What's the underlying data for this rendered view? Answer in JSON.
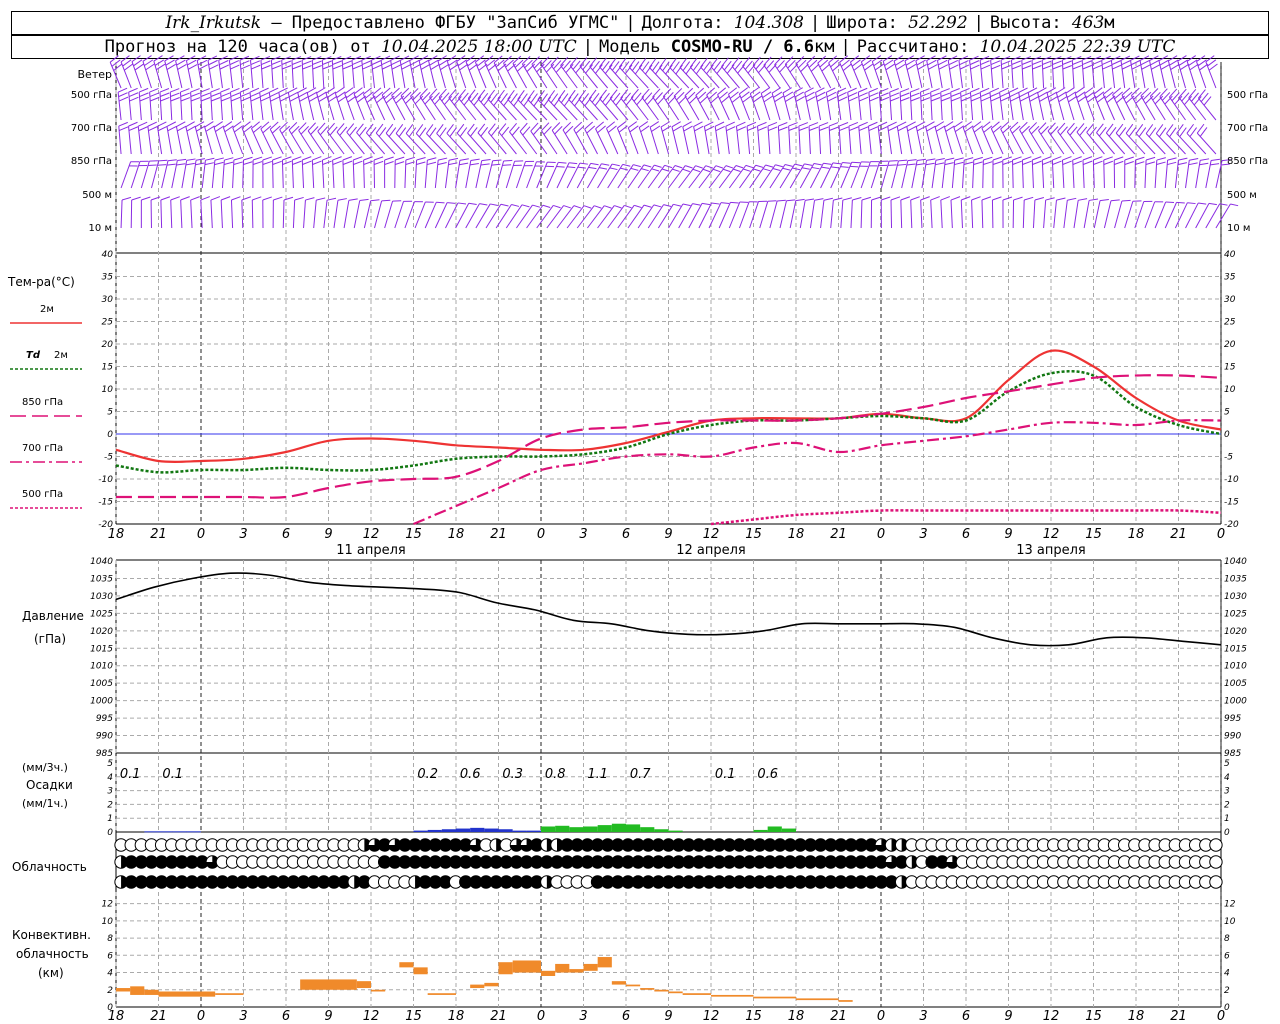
{
  "header": {
    "station": "Irk_Irkutsk",
    "provider": "— Предоставлено ФГБУ \"ЗапСиб УГМС\"",
    "lon_label": "Долгота:",
    "lon": "104.308",
    "lat_label": "Широта:",
    "lat": "52.292",
    "alt_label": "Высота:",
    "alt": "463",
    "alt_unit": "м",
    "forecast_label": "Прогноз на 120 часа(ов) от",
    "start": "10.04.2025 18:00 UTC",
    "model_label": "Модель",
    "model": "COSMO-RU / 6.6",
    "model_unit": "км",
    "calc_label": "Рассчитано:",
    "calc_time": "10.04.2025 22:39 UTC"
  },
  "wind_panel": {
    "title": "Ветер",
    "levels": [
      "500 гПа",
      "700 гПа",
      "850 гПа",
      "500 м",
      "10  м"
    ],
    "levels_right": [
      "500 гПа",
      "700 гПа",
      "850 гПа",
      "500 м",
      "10  м"
    ],
    "color": "#8a2be2"
  },
  "temp_panel": {
    "title": "Тем-ра(°С)",
    "legend": [
      {
        "label": "2м",
        "prefix": "",
        "color": "#ee3333",
        "dash": ""
      },
      {
        "label": "2м",
        "prefix": "Td",
        "color": "#117711",
        "dash": "3,2"
      },
      {
        "label": "850 гПа",
        "prefix": "",
        "color": "#dd1177",
        "dash": "16,6"
      },
      {
        "label": "700 гПа",
        "prefix": "",
        "color": "#dd1177",
        "dash": "12,4,3,4"
      },
      {
        "label": "500 гПа",
        "prefix": "",
        "color": "#dd1177",
        "dash": "3,2"
      }
    ]
  },
  "time_axis": {
    "ticks": [
      "18",
      "21",
      "0",
      "3",
      "6",
      "9",
      "12",
      "15",
      "18",
      "21",
      "0",
      "3",
      "6",
      "9",
      "12",
      "15",
      "18",
      "21",
      "0",
      "3",
      "6",
      "9",
      "12",
      "15",
      "18",
      "21",
      "0"
    ],
    "dates": [
      "11 апреля",
      "12 апреля",
      "13 апреля"
    ]
  },
  "pressure_panel": {
    "title": "Давление",
    "unit": "(гПа)"
  },
  "precip_panel": {
    "unit_top": "(мм/3ч.)",
    "title": "Осадки",
    "unit_bottom": "(мм/1ч.)",
    "labels": [
      {
        "t": 1,
        "v": "0.1"
      },
      {
        "t": 4,
        "v": "0.1"
      },
      {
        "t": 22,
        "v": "0.2"
      },
      {
        "t": 25,
        "v": "0.6"
      },
      {
        "t": 28,
        "v": "0.3"
      },
      {
        "t": 31,
        "v": "0.8"
      },
      {
        "t": 34,
        "v": "1.1"
      },
      {
        "t": 37,
        "v": "0.7"
      },
      {
        "t": 43,
        "v": "0.1"
      },
      {
        "t": 46,
        "v": "0.6"
      }
    ]
  },
  "cloud_panel": {
    "title": "Облачность"
  },
  "conv_panel": {
    "title_1": "Конвективн.",
    "title_2": "облачность",
    "unit": "(км)"
  },
  "chart_data": [
    {
      "type": "line",
      "name": "temperature",
      "x_hours_from_start": [
        0,
        3,
        6,
        9,
        12,
        15,
        18,
        21,
        24,
        27,
        30,
        33,
        36,
        39,
        42,
        45,
        48,
        51,
        54,
        57,
        60,
        63,
        66,
        69,
        72,
        75,
        78
      ],
      "series": [
        {
          "name": "2м",
          "values": [
            -3.5,
            -6,
            -6,
            -5.5,
            -4,
            -1.5,
            -1,
            -1.5,
            -2.5,
            -3,
            -3.5,
            -3.5,
            -2,
            0.5,
            3,
            3.5,
            3.5,
            3.5,
            4.5,
            3.5,
            3.5,
            12,
            18.5,
            15,
            8,
            3,
            1
          ]
        },
        {
          "name": "Td 2м",
          "values": [
            -7,
            -8.5,
            -8,
            -8,
            -7.5,
            -8,
            -8,
            -7,
            -5.5,
            -5,
            -5,
            -4.5,
            -3,
            0,
            2,
            3,
            3,
            3.5,
            4,
            3.5,
            3,
            9.5,
            13.5,
            13,
            6,
            2,
            0
          ]
        },
        {
          "name": "850 гПа",
          "values": [
            -14,
            -14,
            -14,
            -14,
            -14,
            -12,
            -10.5,
            -10,
            -9.5,
            -6,
            -1,
            1,
            1.5,
            2.5,
            3,
            3,
            3,
            3.5,
            4.5,
            6,
            8,
            9.5,
            11,
            12.5,
            13,
            13,
            12.5
          ]
        },
        {
          "name": "700 гПа",
          "values": [
            null,
            null,
            null,
            null,
            null,
            null,
            null,
            -24,
            -16,
            -12,
            -8,
            -6.5,
            -5,
            -4.5,
            -5,
            -3,
            -2,
            -4,
            -2.5,
            -1.5,
            -0.5,
            1,
            2.5,
            2.5,
            2,
            3,
            3
          ]
        },
        {
          "name": "500 гПа",
          "values": [
            null,
            null,
            null,
            null,
            null,
            null,
            null,
            null,
            null,
            null,
            null,
            null,
            null,
            null,
            -20,
            -19,
            -18,
            -17.5,
            -17,
            -17,
            -17,
            -17,
            -17,
            -17,
            -17,
            -17,
            -17.5
          ]
        }
      ],
      "ylim": [
        -20,
        40
      ],
      "yticks": [
        -20,
        -15,
        -10,
        -5,
        0,
        5,
        10,
        15,
        20,
        25,
        30,
        35,
        40
      ],
      "zero_line_color": "#3333ee"
    },
    {
      "type": "line",
      "name": "pressure",
      "x_hours_from_start": [
        0,
        3,
        6,
        9,
        12,
        15,
        18,
        21,
        24,
        27,
        30,
        33,
        36,
        39,
        42,
        45,
        48,
        51,
        54,
        57,
        60,
        63,
        66,
        69,
        72,
        75,
        78
      ],
      "series": [
        {
          "name": "Давление",
          "values": [
            1029,
            1032.5,
            1035,
            1036.5,
            1036,
            1034,
            1033,
            1032.5,
            1032,
            1031,
            1028,
            1026,
            1023,
            1022,
            1020,
            1019,
            1019,
            1020,
            1022,
            1022,
            1022,
            1022,
            1021,
            1018,
            1016,
            1016,
            1018,
            1018,
            1017,
            1016
          ]
        }
      ],
      "ylim": [
        985,
        1040
      ],
      "yticks": [
        985,
        990,
        995,
        1000,
        1005,
        1010,
        1015,
        1020,
        1025,
        1030,
        1035,
        1040
      ]
    },
    {
      "type": "bar",
      "name": "precipitation",
      "unit": "мм/1ч",
      "ylim": [
        0,
        5
      ],
      "yticks": [
        0,
        1,
        2,
        3,
        4,
        5
      ],
      "colors": {
        "snow": "#2233cc",
        "rain": "#22bb22"
      },
      "bars": [
        {
          "t": 2,
          "v": 0.05,
          "kind": "snow"
        },
        {
          "t": 3,
          "v": 0.05,
          "kind": "snow"
        },
        {
          "t": 4,
          "v": 0.05,
          "kind": "snow"
        },
        {
          "t": 5,
          "v": 0.05,
          "kind": "snow"
        },
        {
          "t": 21,
          "v": 0.1,
          "kind": "snow"
        },
        {
          "t": 22,
          "v": 0.15,
          "kind": "snow"
        },
        {
          "t": 23,
          "v": 0.2,
          "kind": "snow"
        },
        {
          "t": 24,
          "v": 0.25,
          "kind": "snow"
        },
        {
          "t": 25,
          "v": 0.3,
          "kind": "snow"
        },
        {
          "t": 26,
          "v": 0.25,
          "kind": "snow"
        },
        {
          "t": 27,
          "v": 0.2,
          "kind": "snow"
        },
        {
          "t": 28,
          "v": 0.1,
          "kind": "snow"
        },
        {
          "t": 29,
          "v": 0.1,
          "kind": "snow"
        },
        {
          "t": 30,
          "v": 0.4,
          "kind": "rain"
        },
        {
          "t": 31,
          "v": 0.45,
          "kind": "rain"
        },
        {
          "t": 32,
          "v": 0.35,
          "kind": "rain"
        },
        {
          "t": 33,
          "v": 0.4,
          "kind": "rain"
        },
        {
          "t": 34,
          "v": 0.5,
          "kind": "rain"
        },
        {
          "t": 35,
          "v": 0.6,
          "kind": "rain"
        },
        {
          "t": 36,
          "v": 0.55,
          "kind": "rain"
        },
        {
          "t": 37,
          "v": 0.35,
          "kind": "rain"
        },
        {
          "t": 38,
          "v": 0.2,
          "kind": "rain"
        },
        {
          "t": 39,
          "v": 0.1,
          "kind": "rain"
        },
        {
          "t": 45,
          "v": 0.15,
          "kind": "rain"
        },
        {
          "t": 46,
          "v": 0.4,
          "kind": "rain"
        },
        {
          "t": 47,
          "v": 0.25,
          "kind": "rain"
        }
      ]
    },
    {
      "type": "table",
      "name": "cloudiness",
      "levels": 3,
      "note": "oktas per hour: 0 empty circle, 8 full circle",
      "rows": [
        [
          0,
          0,
          0,
          0,
          0,
          0,
          0,
          0,
          0,
          0,
          0,
          0,
          0,
          0,
          0,
          0,
          0,
          0,
          0,
          0,
          0,
          0,
          0,
          0,
          4,
          6,
          8,
          6,
          8,
          8,
          8,
          8,
          8,
          8,
          8,
          6,
          0,
          4,
          0,
          6,
          6,
          8,
          4,
          4,
          8,
          8,
          8,
          8,
          8,
          8,
          8,
          8,
          8,
          8,
          8,
          8,
          8,
          8,
          8,
          8,
          8,
          8,
          8,
          8,
          8,
          8,
          8,
          8,
          8,
          8,
          8,
          8,
          8,
          8,
          8,
          6,
          4,
          4,
          0,
          0,
          0,
          0,
          0,
          0,
          0,
          0,
          0,
          0,
          0,
          0,
          0,
          0,
          0,
          0,
          0,
          0,
          0,
          0,
          0,
          0,
          0,
          0,
          0,
          0,
          0,
          0,
          0,
          0,
          0
        ],
        [
          4,
          8,
          8,
          8,
          8,
          8,
          8,
          8,
          8,
          6,
          0,
          0,
          0,
          0,
          0,
          0,
          0,
          0,
          0,
          0,
          0,
          0,
          0,
          0,
          0,
          0,
          8,
          8,
          8,
          8,
          8,
          8,
          8,
          8,
          8,
          8,
          8,
          8,
          8,
          8,
          8,
          8,
          8,
          8,
          8,
          8,
          8,
          8,
          8,
          8,
          8,
          8,
          8,
          8,
          8,
          8,
          8,
          8,
          8,
          8,
          8,
          8,
          8,
          8,
          8,
          8,
          8,
          8,
          8,
          8,
          8,
          8,
          8,
          8,
          8,
          8,
          6,
          8,
          4,
          0,
          8,
          8,
          6,
          0,
          0,
          0,
          0,
          0,
          0,
          0,
          0,
          0,
          0,
          0,
          0,
          0,
          0,
          0,
          0,
          0,
          0,
          0,
          0,
          0,
          0,
          0,
          0,
          0,
          0
        ],
        [
          4,
          8,
          8,
          8,
          8,
          8,
          8,
          8,
          8,
          8,
          8,
          8,
          8,
          8,
          8,
          8,
          8,
          8,
          8,
          8,
          8,
          8,
          8,
          4,
          8,
          0,
          0,
          0,
          0,
          4,
          8,
          8,
          8,
          0,
          8,
          8,
          8,
          8,
          8,
          8,
          8,
          8,
          4,
          0,
          0,
          0,
          0,
          8,
          8,
          8,
          8,
          8,
          8,
          8,
          8,
          8,
          8,
          8,
          8,
          8,
          8,
          8,
          8,
          8,
          8,
          8,
          8,
          8,
          8,
          8,
          8,
          8,
          8,
          8,
          8,
          8,
          8,
          4,
          0,
          0,
          0,
          0,
          0,
          0,
          0,
          0,
          0,
          0,
          0,
          0,
          0,
          0,
          0,
          0,
          0,
          0,
          0,
          0,
          0,
          0,
          0,
          0,
          0,
          0,
          0,
          0,
          0,
          0,
          0
        ]
      ]
    },
    {
      "type": "bar",
      "name": "convective_cloudiness",
      "unit": "км",
      "ylim": [
        0,
        13
      ],
      "yticks": [
        0,
        2,
        4,
        6,
        8,
        10,
        12
      ],
      "color": "#f08a2a",
      "bars": [
        {
          "t0": 0,
          "t1": 1,
          "bot": 1.8,
          "top": 2.2
        },
        {
          "t0": 1,
          "t1": 2,
          "bot": 1.4,
          "top": 2.4
        },
        {
          "t0": 2,
          "t1": 3,
          "bot": 1.4,
          "top": 2.0
        },
        {
          "t0": 3,
          "t1": 6,
          "bot": 1.2,
          "top": 1.8
        },
        {
          "t0": 6,
          "t1": 7,
          "bot": 1.2,
          "top": 1.8
        },
        {
          "t0": 7,
          "t1": 9,
          "bot": 1.4,
          "top": 1.6
        },
        {
          "t0": 13,
          "t1": 17,
          "bot": 2.0,
          "top": 3.2
        },
        {
          "t0": 17,
          "t1": 18,
          "bot": 2.2,
          "top": 3.0
        },
        {
          "t0": 18,
          "t1": 19,
          "bot": 1.8,
          "top": 2.0
        },
        {
          "t0": 20,
          "t1": 21,
          "bot": 4.6,
          "top": 5.2
        },
        {
          "t0": 21,
          "t1": 22,
          "bot": 3.8,
          "top": 4.6
        },
        {
          "t0": 22,
          "t1": 24,
          "bot": 1.4,
          "top": 1.6
        },
        {
          "t0": 25,
          "t1": 26,
          "bot": 2.2,
          "top": 2.6
        },
        {
          "t0": 26,
          "t1": 27,
          "bot": 2.4,
          "top": 2.8
        },
        {
          "t0": 27,
          "t1": 28,
          "bot": 3.8,
          "top": 5.2
        },
        {
          "t0": 28,
          "t1": 30,
          "bot": 4.0,
          "top": 5.4
        },
        {
          "t0": 30,
          "t1": 31,
          "bot": 3.6,
          "top": 4.2
        },
        {
          "t0": 31,
          "t1": 32,
          "bot": 4.0,
          "top": 5.0
        },
        {
          "t0": 32,
          "t1": 33,
          "bot": 4.0,
          "top": 4.4
        },
        {
          "t0": 33,
          "t1": 34,
          "bot": 4.2,
          "top": 5.0
        },
        {
          "t0": 34,
          "t1": 35,
          "bot": 4.6,
          "top": 5.8
        },
        {
          "t0": 35,
          "t1": 36,
          "bot": 2.6,
          "top": 3.0
        },
        {
          "t0": 36,
          "t1": 37,
          "bot": 2.4,
          "top": 2.6
        },
        {
          "t0": 37,
          "t1": 38,
          "bot": 2.0,
          "top": 2.2
        },
        {
          "t0": 38,
          "t1": 39,
          "bot": 1.8,
          "top": 2.0
        },
        {
          "t0": 39,
          "t1": 40,
          "bot": 1.6,
          "top": 1.8
        },
        {
          "t0": 40,
          "t1": 42,
          "bot": 1.4,
          "top": 1.6
        },
        {
          "t0": 42,
          "t1": 45,
          "bot": 1.2,
          "top": 1.4
        },
        {
          "t0": 45,
          "t1": 48,
          "bot": 1.0,
          "top": 1.2
        },
        {
          "t0": 48,
          "t1": 51,
          "bot": 0.8,
          "top": 1.0
        },
        {
          "t0": 51,
          "t1": 52,
          "bot": 0.6,
          "top": 0.8
        }
      ]
    }
  ]
}
